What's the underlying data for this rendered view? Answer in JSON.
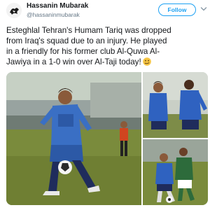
{
  "author": {
    "display_name": "Hassanin Mubarak",
    "handle": "@hassaninmubarak"
  },
  "header": {
    "follow_label": "Follow"
  },
  "tweet": {
    "lines": [
      "Esteghlal Tehran's Humam Tariq was dropped",
      "from Iraq's squad due to an injury. He played",
      "in a friendly for his former club Al-Quwa Al-",
      "Jawiya in a 1-0 win over Al-Taji today!"
    ],
    "emoji": "grimace-face-icon"
  },
  "media": {
    "photos": [
      {
        "name": "main-action-photo",
        "jersey_color": "#3a6fc4"
      },
      {
        "name": "players-group-photo",
        "jersey_color": "#2f62c0"
      },
      {
        "name": "tackle-photo",
        "jersey_color": "#2f62c0"
      }
    ],
    "colors": {
      "pitch": "#7a8b3c",
      "sky": "#b9c5b4",
      "opponent_kit": "#2d6b3b"
    }
  }
}
